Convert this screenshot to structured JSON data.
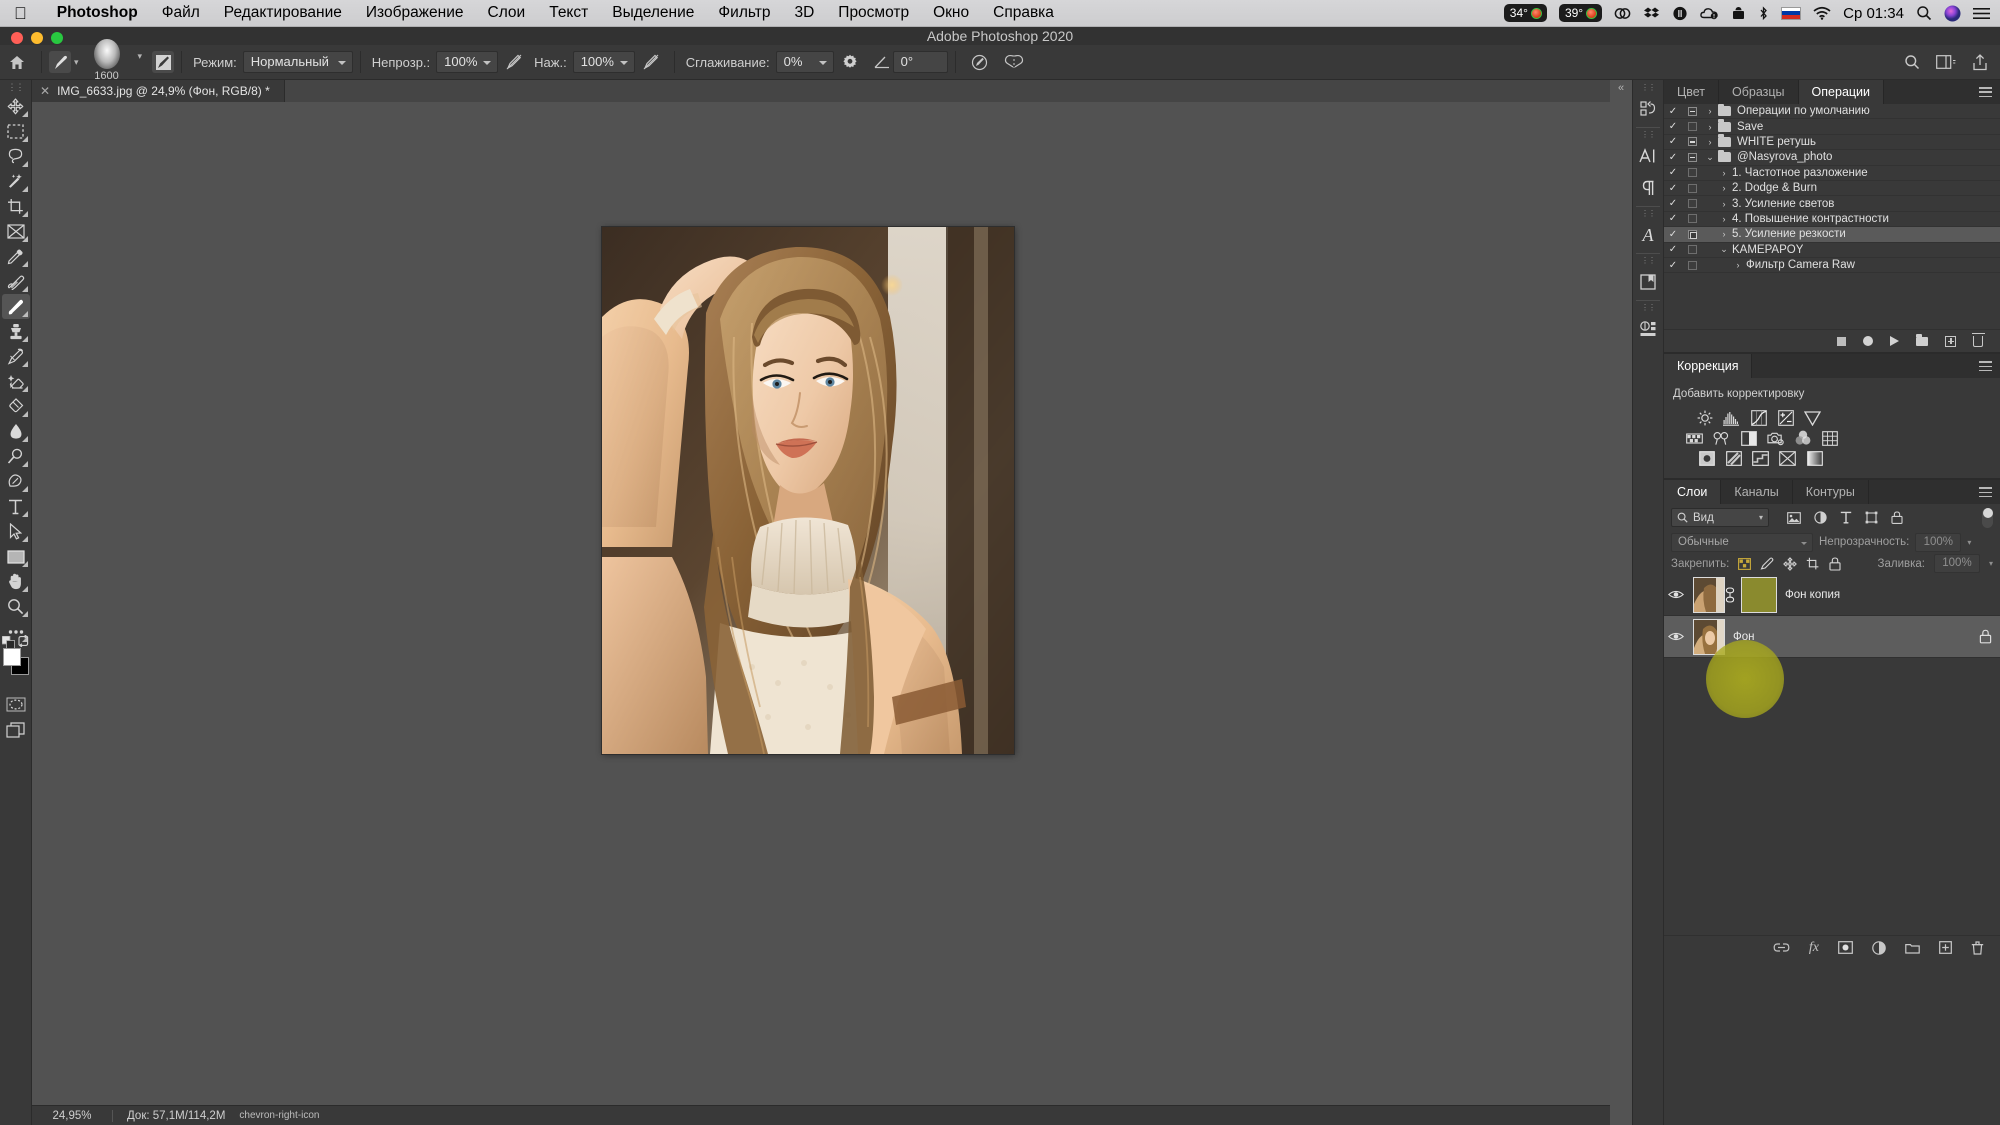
{
  "macbar": {
    "apple_icon": "apple-icon",
    "app_name": "Photoshop",
    "menus": [
      "Файл",
      "Редактирование",
      "Изображение",
      "Слои",
      "Текст",
      "Выделение",
      "Фильтр",
      "3D",
      "Просмотр",
      "Окно",
      "Справка"
    ],
    "status": {
      "temp1": "34°",
      "temp2": "39°",
      "icons": [
        "creative-cloud-icon",
        "dropbox-icon",
        "cloud-storage-icon",
        "onedrive-icon",
        "screen-share-icon",
        "bluetooth-icon"
      ],
      "input_language": "ru-flag-icon",
      "wifi": "wifi-icon",
      "clock": "Ср 01:34",
      "search": "spotlight-search-icon",
      "siri": "siri-icon",
      "control_center": "control-center-icon"
    }
  },
  "window": {
    "title": "Adobe Photoshop 2020"
  },
  "options_bar": {
    "home_icon": "home-icon",
    "brush_preset_icon": "brush-preset-icon",
    "brush_size": "1600",
    "brush_settings_icon": "brush-panel-icon",
    "mode_label": "Режим:",
    "mode_value": "Нормальный",
    "opacity_label": "Непрозр.:",
    "opacity_value": "100%",
    "opacity_pressure_icon": "pressure-opacity-icon",
    "flow_label": "Наж.:",
    "flow_value": "100%",
    "flow_pressure_icon": "pressure-flow-icon",
    "airbrush_icon": "airbrush-icon",
    "smoothing_label": "Сглаживание:",
    "smoothing_value": "0%",
    "smoothing_gear_icon": "gear-icon",
    "angle_icon": "angle-icon",
    "angle_value": "0°",
    "tablet_pressure_icon": "tablet-pressure-icon",
    "symmetry_icon": "symmetry-butterfly-icon",
    "right_icons": [
      "search-icon",
      "workspace-icon",
      "share-icon"
    ]
  },
  "document_tab": {
    "close_icon": "close-icon",
    "title": "IMG_6633.jpg @ 24,9% (Фон, RGB/8) *"
  },
  "toolbar": {
    "tools": [
      {
        "name": "move-tool",
        "icon": "move-icon",
        "active": false
      },
      {
        "name": "rectangular-marquee-tool",
        "icon": "marquee-icon",
        "active": false
      },
      {
        "name": "lasso-tool",
        "icon": "lasso-icon",
        "active": false
      },
      {
        "name": "magic-wand-tool",
        "icon": "magic-wand-icon",
        "active": false
      },
      {
        "name": "crop-tool",
        "icon": "crop-icon",
        "active": false
      },
      {
        "name": "frame-tool",
        "icon": "frame-icon",
        "active": false
      },
      {
        "name": "eyedropper-tool",
        "icon": "eyedropper-icon",
        "active": false
      },
      {
        "name": "healing-brush-tool",
        "icon": "healing-brush-icon",
        "active": false
      },
      {
        "name": "brush-tool",
        "icon": "brush-icon",
        "active": true
      },
      {
        "name": "clone-stamp-tool",
        "icon": "clone-stamp-icon",
        "active": false
      },
      {
        "name": "history-brush-tool",
        "icon": "history-brush-icon",
        "active": false
      },
      {
        "name": "eraser-tool",
        "icon": "eraser-icon",
        "active": false
      },
      {
        "name": "gradient-tool",
        "icon": "gradient-bucket-icon",
        "active": false
      },
      {
        "name": "blur-tool",
        "icon": "blur-drop-icon",
        "active": false
      },
      {
        "name": "dodge-tool",
        "icon": "dodge-icon",
        "active": false
      },
      {
        "name": "pen-tool",
        "icon": "pen-icon",
        "active": false
      },
      {
        "name": "type-tool",
        "icon": "type-icon",
        "active": false
      },
      {
        "name": "path-selection-tool",
        "icon": "path-arrow-icon",
        "active": false
      },
      {
        "name": "rectangle-tool",
        "icon": "rectangle-icon",
        "active": false
      },
      {
        "name": "hand-tool",
        "icon": "hand-icon",
        "active": false
      },
      {
        "name": "zoom-tool",
        "icon": "zoom-icon",
        "active": false
      },
      {
        "name": "edit-toolbar",
        "icon": "ellipsis-icon",
        "active": false
      }
    ],
    "foreground_color": "#ffffff",
    "background_color": "#000000",
    "quick_mask_icon": "quick-mask-icon",
    "screen_mode_icon": "screen-mode-icon"
  },
  "icon_dock": {
    "buttons": [
      {
        "name": "history-panel-icon",
        "glyph": "history"
      },
      {
        "name": "character-panel-icon",
        "glyph": "A|"
      },
      {
        "name": "paragraph-panel-icon",
        "glyph": "¶"
      },
      {
        "name": "glyphs-panel-icon",
        "glyph": "𝒜"
      },
      {
        "name": "libraries-panel-icon",
        "glyph": "book"
      },
      {
        "name": "properties-panel-icon",
        "glyph": "props"
      }
    ],
    "collapse_icon": "collapse-panels-icon"
  },
  "actions_panel": {
    "tabs": [
      {
        "label": "Цвет",
        "active": false
      },
      {
        "label": "Образцы",
        "active": false
      },
      {
        "label": "Операции",
        "active": true
      }
    ],
    "menu_icon": "panel-menu-icon",
    "rows": [
      {
        "check": "✓",
        "box": "filled",
        "arrow": "›",
        "folder": true,
        "indent": 0,
        "label": "Операции по умолчанию",
        "selected": false
      },
      {
        "check": "✓",
        "box": "empty",
        "arrow": "›",
        "folder": true,
        "indent": 0,
        "label": "Save",
        "selected": false
      },
      {
        "check": "✓",
        "box": "filled",
        "arrow": "›",
        "folder": true,
        "indent": 0,
        "label": "WHITE  ретушь",
        "selected": false
      },
      {
        "check": "✓",
        "box": "filled",
        "arrow": "⌄",
        "folder": true,
        "indent": 0,
        "label": "@Nasyrova_photo",
        "selected": false
      },
      {
        "check": "✓",
        "box": "empty",
        "arrow": "›",
        "folder": false,
        "indent": 1,
        "label": "1. Частотное разложение",
        "selected": false
      },
      {
        "check": "✓",
        "box": "empty",
        "arrow": "›",
        "folder": false,
        "indent": 1,
        "label": "2. Dodge & Burn",
        "selected": false
      },
      {
        "check": "✓",
        "box": "empty",
        "arrow": "›",
        "folder": false,
        "indent": 1,
        "label": "3. Усиление светов",
        "selected": false
      },
      {
        "check": "✓",
        "box": "empty",
        "arrow": "›",
        "folder": false,
        "indent": 1,
        "label": "4. Повышение контрастности",
        "selected": false
      },
      {
        "check": "✓",
        "box": "square2",
        "arrow": "›",
        "folder": false,
        "indent": 1,
        "label": "5. Усиление резкости",
        "selected": true
      },
      {
        "check": "✓",
        "box": "empty",
        "arrow": "⌄",
        "folder": false,
        "indent": 1,
        "label": "KAMEPAPOY",
        "selected": false
      },
      {
        "check": "✓",
        "box": "empty",
        "arrow": "›",
        "folder": false,
        "indent": 2,
        "label": "Фильтр Camera Raw",
        "selected": false
      }
    ],
    "footer_icons": [
      "stop-icon",
      "record-icon",
      "play-icon",
      "new-set-icon",
      "new-action-icon",
      "delete-icon"
    ]
  },
  "adjustments_panel": {
    "tab_label": "Коррекция",
    "menu_icon": "panel-menu-icon",
    "subtitle": "Добавить корректировку",
    "rows": [
      [
        "brightness-contrast-icon",
        "levels-icon",
        "curves-icon",
        "exposure-icon",
        "vibrance-icon"
      ],
      [
        "hue-saturation-icon",
        "color-balance-icon",
        "black-white-icon",
        "photo-filter-icon",
        "channel-mixer-icon",
        "color-lookup-icon"
      ],
      [
        "invert-icon",
        "posterize-icon",
        "threshold-icon",
        "selective-color-icon",
        "gradient-map-icon"
      ]
    ]
  },
  "layers_panel": {
    "tabs": [
      {
        "label": "Слои",
        "active": true
      },
      {
        "label": "Каналы",
        "active": false
      },
      {
        "label": "Контуры",
        "active": false
      }
    ],
    "menu_icon": "panel-menu-icon",
    "filter": {
      "search_icon": "search-icon",
      "value": "Вид",
      "type_icons": [
        "filter-image-icon",
        "filter-adjustment-icon",
        "filter-type-icon",
        "filter-shape-icon",
        "filter-smart-icon"
      ],
      "toggle_name": "filter-enable-toggle"
    },
    "blend_mode": "Обычные",
    "opacity_label": "Непрозрачность:",
    "opacity_value": "100%",
    "lock_label": "Закрепить:",
    "lock_icons": [
      "lock-transparent-icon",
      "lock-image-icon",
      "lock-position-icon",
      "lock-artboard-icon",
      "lock-all-icon"
    ],
    "fill_label": "Заливка:",
    "fill_value": "100%",
    "layers": [
      {
        "name": "Фон копия",
        "visible": true,
        "selected": false,
        "has_mask": true,
        "linked": true,
        "locked": false
      },
      {
        "name": "Фон",
        "visible": true,
        "selected": true,
        "has_mask": false,
        "linked": false,
        "locked": true
      }
    ],
    "footer_icons": [
      "link-layers-icon",
      "fx-icon",
      "add-mask-icon",
      "new-adjustment-icon",
      "new-group-icon",
      "new-layer-icon",
      "delete-layer-icon"
    ]
  },
  "status_bar": {
    "zoom": "24,95%",
    "doc_info": "Док: 57,1M/114,2M",
    "expand_icon": "chevron-right-icon"
  },
  "canvas": {
    "image_alt": "portrait-photo-woman-beige-coat"
  },
  "colors": {
    "app_bg": "#535353",
    "panel_bg": "#393939",
    "panel_tab_bg": "#2f2f2f",
    "selection": "#5d5d5d",
    "highlight": "#b0b01e",
    "text": "#d4d4d4"
  }
}
